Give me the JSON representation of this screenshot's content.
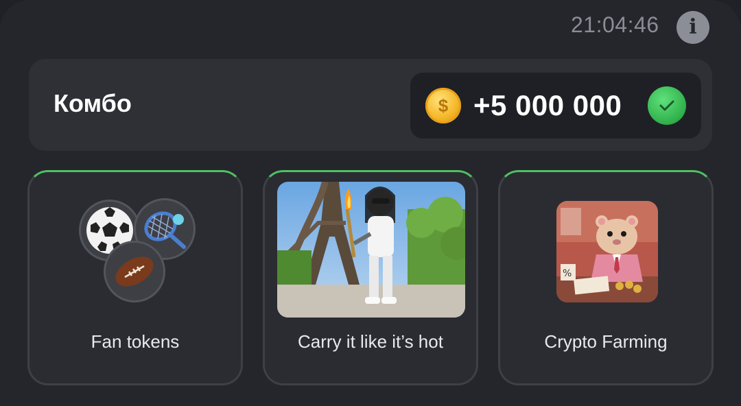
{
  "header": {
    "time": "21:04:46",
    "info_icon": "info-icon"
  },
  "combo": {
    "label": "Комбо",
    "reward": "+5 000 000",
    "coin_icon": "coin-icon",
    "status_icon": "check-icon",
    "status_color": "#2fb04a"
  },
  "cards": [
    {
      "label": "Fan tokens",
      "image": "sports-balls-icon"
    },
    {
      "label": "Carry it like it’s hot",
      "image": "hamster-torch-eiffel-image"
    },
    {
      "label": "Crypto Farming",
      "image": "hamster-banker-image"
    }
  ],
  "colors": {
    "background": "#24262c",
    "card_accent": "#4fc062",
    "coin": "#f5b82a"
  }
}
